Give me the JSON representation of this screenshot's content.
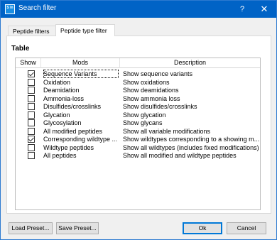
{
  "window": {
    "title": "Search filter",
    "app_icon_text": "S ln",
    "help_label": "?",
    "close_label": "✕"
  },
  "tabs": [
    {
      "label": "Peptide filters",
      "active": false
    },
    {
      "label": "Peptide type filter",
      "active": true
    }
  ],
  "table": {
    "title": "Table",
    "columns": [
      "Show",
      "Mods",
      "Description"
    ],
    "rows": [
      {
        "show": true,
        "mods": "Sequence Variants",
        "description": "Show sequence variants"
      },
      {
        "show": false,
        "mods": "Oxidation",
        "description": "Show oxidations"
      },
      {
        "show": false,
        "mods": "Deamidation",
        "description": "Show deamidations"
      },
      {
        "show": false,
        "mods": "Ammonia-loss",
        "description": "Show ammonia loss"
      },
      {
        "show": false,
        "mods": "Disulfides/crosslinks",
        "description": "Show disulfides/crosslinks"
      },
      {
        "show": false,
        "mods": "Glycation",
        "description": "Show glycation"
      },
      {
        "show": false,
        "mods": "Glycosylation",
        "description": "Show glycans"
      },
      {
        "show": false,
        "mods": "All modified peptides",
        "description": "Show all variable modifications"
      },
      {
        "show": true,
        "mods": "Corresponding wildtype ...",
        "description": "Show wildtypes corresponding to a showing m..."
      },
      {
        "show": false,
        "mods": "Wildtype peptides",
        "description": "Show all wildtypes (includes fixed modifications)"
      },
      {
        "show": false,
        "mods": "All peptides",
        "description": "Show all modified and wildtype peptides"
      }
    ]
  },
  "buttons": {
    "load_preset": "Load Preset...",
    "save_preset": "Save Preset...",
    "ok": "Ok",
    "cancel": "Cancel"
  },
  "colors": {
    "titlebar": "#0063c6",
    "accent": "#0078d7"
  }
}
